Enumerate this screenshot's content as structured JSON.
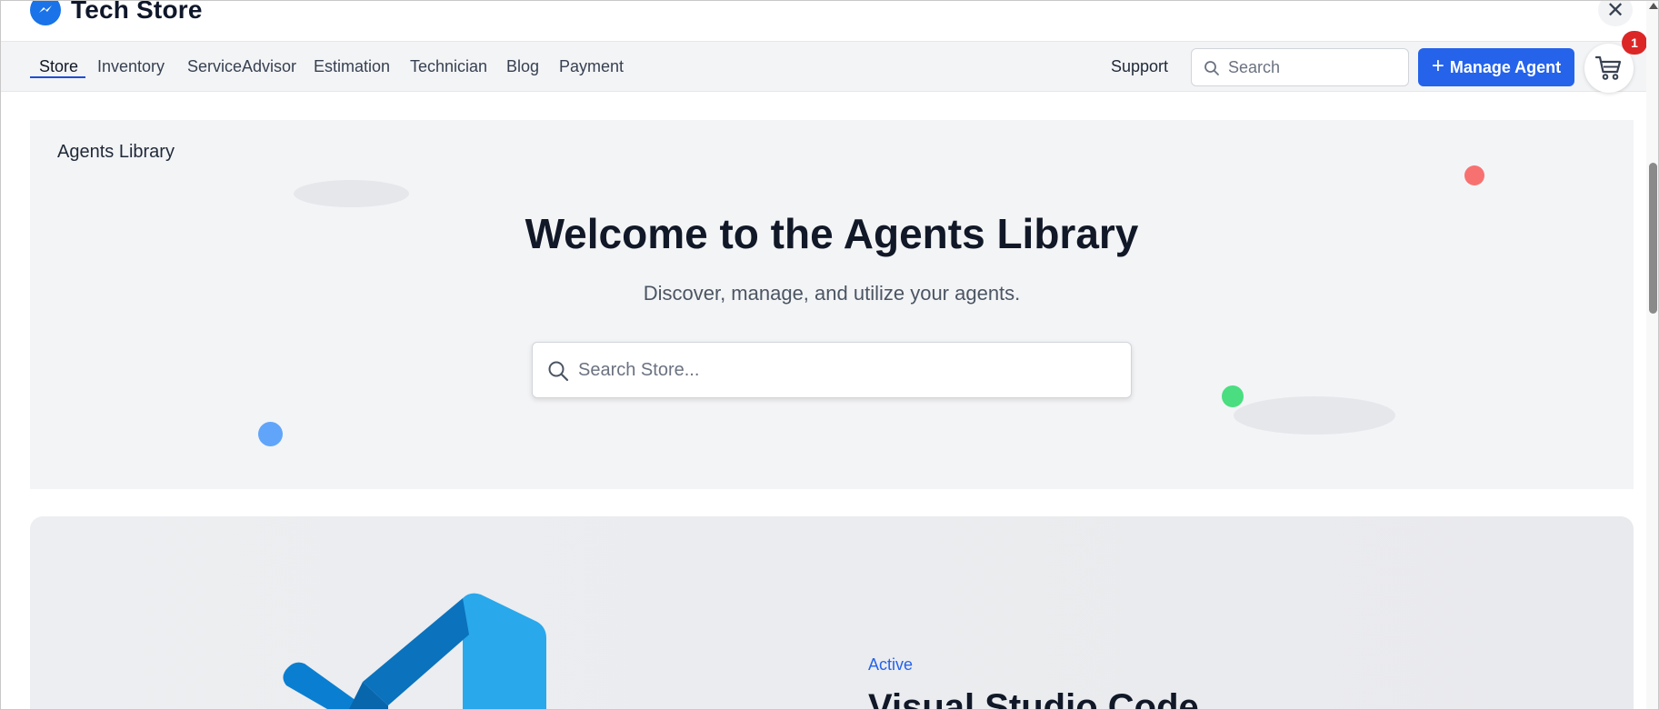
{
  "app": {
    "title": "Tech Store",
    "logo_icon": "messenger-icon",
    "close_icon": "close-icon"
  },
  "nav": {
    "items": [
      {
        "label": "Store",
        "active": true
      },
      {
        "label": "Inventory"
      },
      {
        "label": "ServiceAdvisor"
      },
      {
        "label": "Estimation"
      },
      {
        "label": "Technician"
      },
      {
        "label": "Blog"
      },
      {
        "label": "Payment"
      }
    ],
    "support_label": "Support",
    "search_placeholder": "Search",
    "manage_label": "Manage Agent",
    "cart_count": "1"
  },
  "hero": {
    "label": "Agents Library",
    "title": "Welcome to the Agents Library",
    "subtitle": "Discover, manage, and utilize your agents.",
    "search_placeholder": "Search Store..."
  },
  "feature": {
    "status": "Active",
    "title": "Visual Studio Code",
    "logo_icon": "vscode-logo-icon"
  },
  "colors": {
    "accent": "#2563eb",
    "badge": "#dc2626",
    "dot_red": "#f87171",
    "dot_green": "#4ade80",
    "dot_blue": "#60a5fa"
  }
}
